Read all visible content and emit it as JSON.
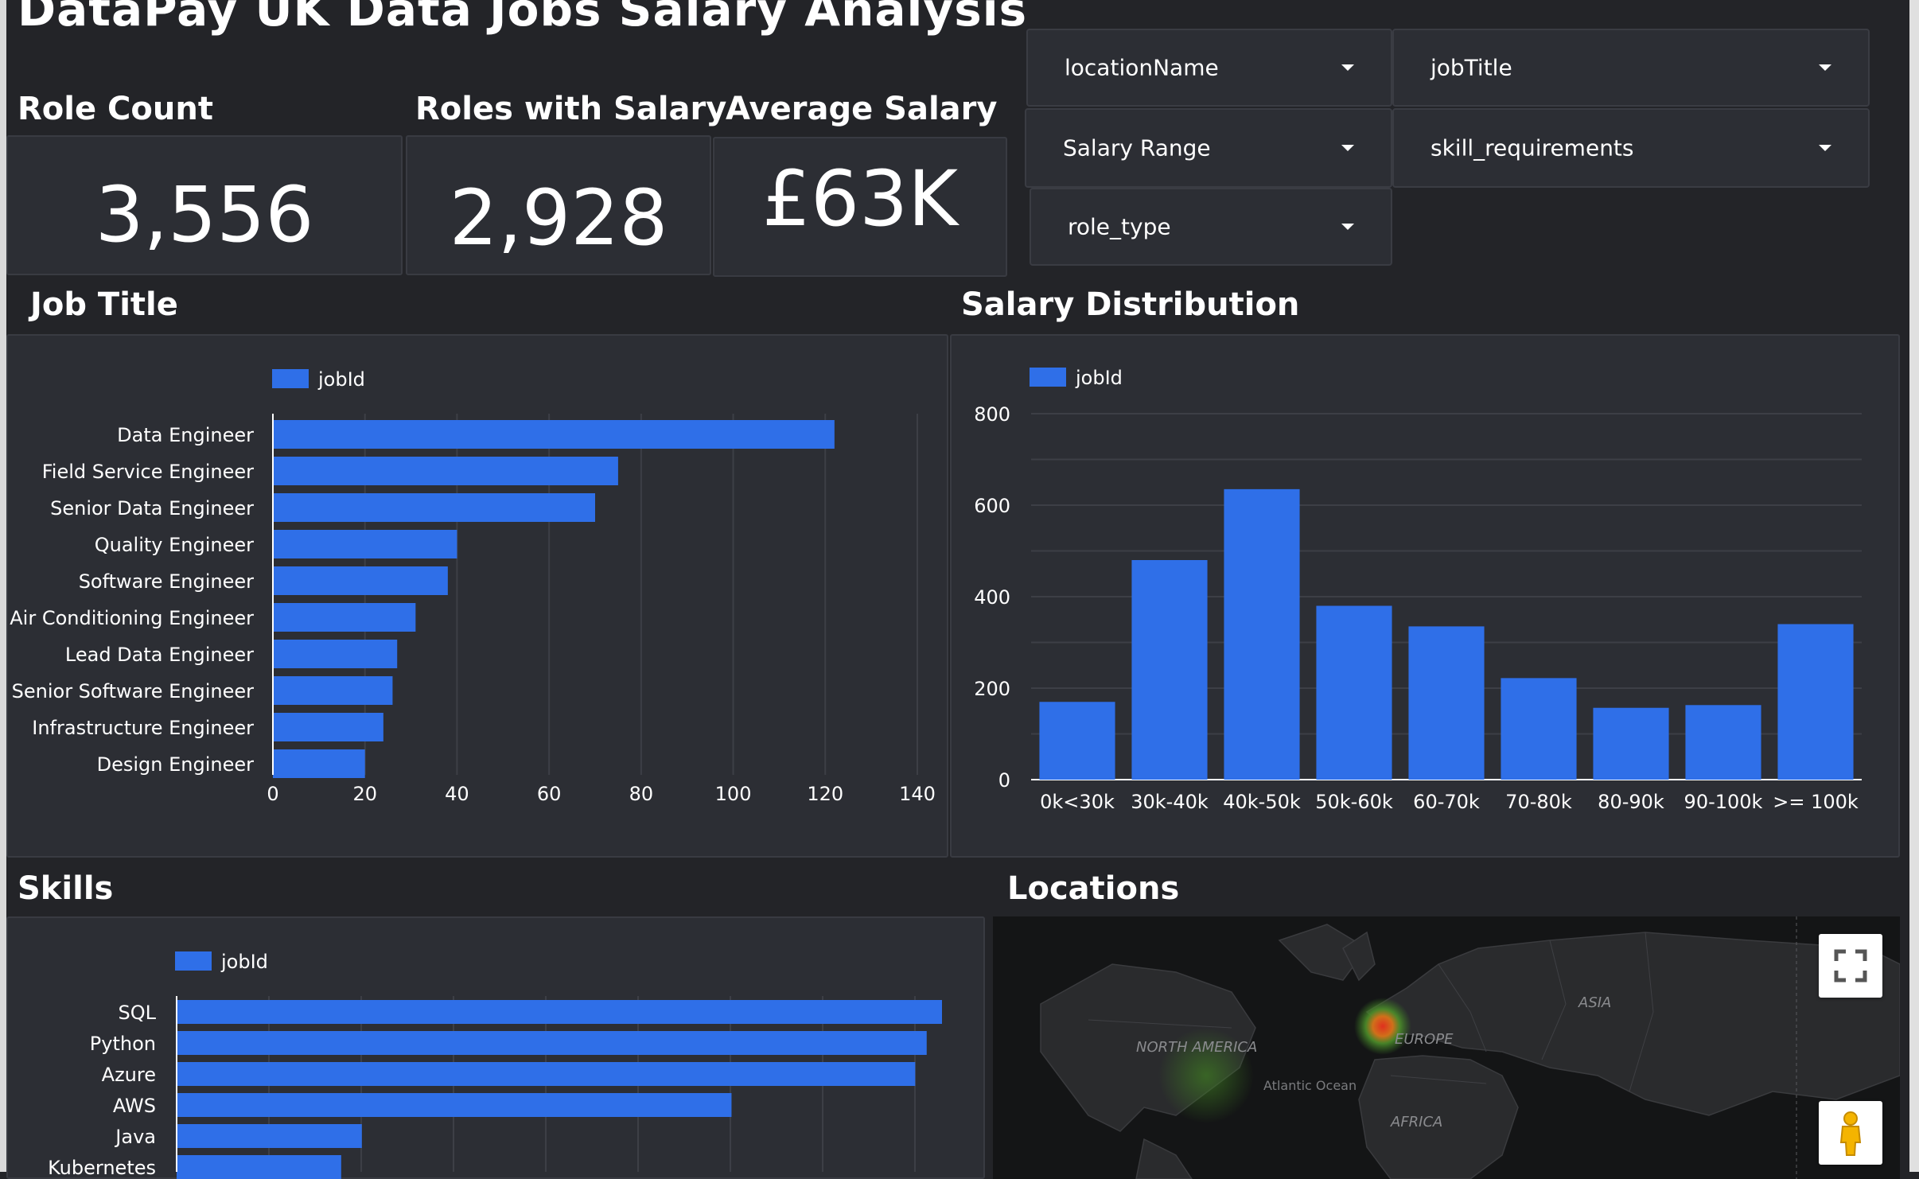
{
  "page": {
    "title": "DataPay UK Data Jobs Salary Analysis"
  },
  "kpis": [
    {
      "label": "Role Count",
      "value": "3,556"
    },
    {
      "label": "Roles with Salary",
      "value": "2,928"
    },
    {
      "label": "Average Salary",
      "value": "£63K"
    }
  ],
  "filters": [
    {
      "label": "locationName"
    },
    {
      "label": "jobTitle"
    },
    {
      "label": "Salary Range"
    },
    {
      "label": "skill_requirements"
    },
    {
      "label": "role_type"
    }
  ],
  "sections": {
    "job_title": "Job Title",
    "salary_distribution": "Salary Distribution",
    "skills": "Skills",
    "locations": "Locations"
  },
  "map": {
    "labels": [
      "NORTH AMERICA",
      "EUROPE",
      "ASIA",
      "AFRICA",
      "Atlantic Ocean"
    ],
    "fullscreen_icon": "fullscreen-icon",
    "pegman_icon": "street-view-pegman-icon"
  },
  "colors": {
    "bar": "#2f6fe8",
    "background": "#232428",
    "panel": "#2c2e34",
    "grid": "#3d3f46"
  },
  "chart_data": [
    {
      "type": "bar",
      "orientation": "horizontal",
      "title": "Job Title",
      "legend": "jobId",
      "legend_position": "top-left",
      "categories": [
        "Data Engineer",
        "Field Service Engineer",
        "Senior Data Engineer",
        "Quality Engineer",
        "Software Engineer",
        "Air Conditioning Engineer",
        "Lead Data Engineer",
        "Senior Software Engineer",
        "Infrastructure Engineer",
        "Design Engineer"
      ],
      "series": [
        {
          "name": "jobId",
          "values": [
            122,
            75,
            70,
            40,
            38,
            31,
            27,
            26,
            24,
            20
          ]
        }
      ],
      "xlim": [
        0,
        140
      ],
      "xticks": [
        "0",
        "20",
        "40",
        "60",
        "80",
        "100",
        "120",
        "140"
      ],
      "grid": true
    },
    {
      "type": "bar",
      "orientation": "vertical",
      "title": "Salary Distribution",
      "legend": "jobId",
      "legend_position": "top-left",
      "categories": [
        "0k<30k",
        "30k-40k",
        "40k-50k",
        "50k-60k",
        "60-70k",
        "70-80k",
        "80-90k",
        "90-100k",
        ">= 100k"
      ],
      "series": [
        {
          "name": "jobId",
          "values": [
            170,
            480,
            635,
            380,
            335,
            222,
            157,
            163,
            340
          ]
        }
      ],
      "ylim": [
        0,
        800
      ],
      "yticks": [
        "0",
        "200",
        "400",
        "600",
        "800"
      ],
      "grid": true
    },
    {
      "type": "bar",
      "orientation": "horizontal",
      "title": "Skills",
      "legend": "jobId",
      "legend_position": "top-left",
      "categories": [
        "SQL",
        "Python",
        "Azure",
        "AWS",
        "Java",
        "Kubernetes"
      ],
      "series": [
        {
          "name": "jobId",
          "values": [
            1000,
            980,
            965,
            725,
            242,
            215
          ]
        }
      ],
      "grid": true
    }
  ]
}
